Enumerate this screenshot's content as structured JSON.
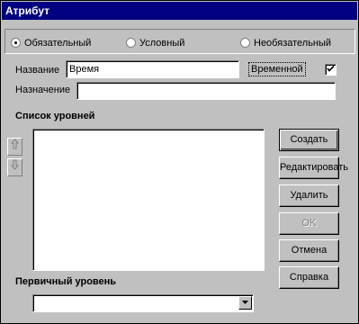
{
  "window": {
    "title": "Атрибут"
  },
  "radios": {
    "mandatory": "Обязательный",
    "conditional": "Условный",
    "optional": "Необязательный"
  },
  "form": {
    "name_label": "Название",
    "name_value": "Время",
    "temporal_label": "Временной",
    "temporal_checked": true,
    "purpose_label": "Назначение",
    "purpose_value": ""
  },
  "levels": {
    "label": "Список уровней",
    "items": []
  },
  "primary_level": {
    "label": "Первичный уровень",
    "value": ""
  },
  "buttons": {
    "create": "Создать",
    "edit": "Редактировать",
    "delete": "Удалить",
    "ok": "OK",
    "cancel": "Отмена",
    "help": "Справка"
  }
}
